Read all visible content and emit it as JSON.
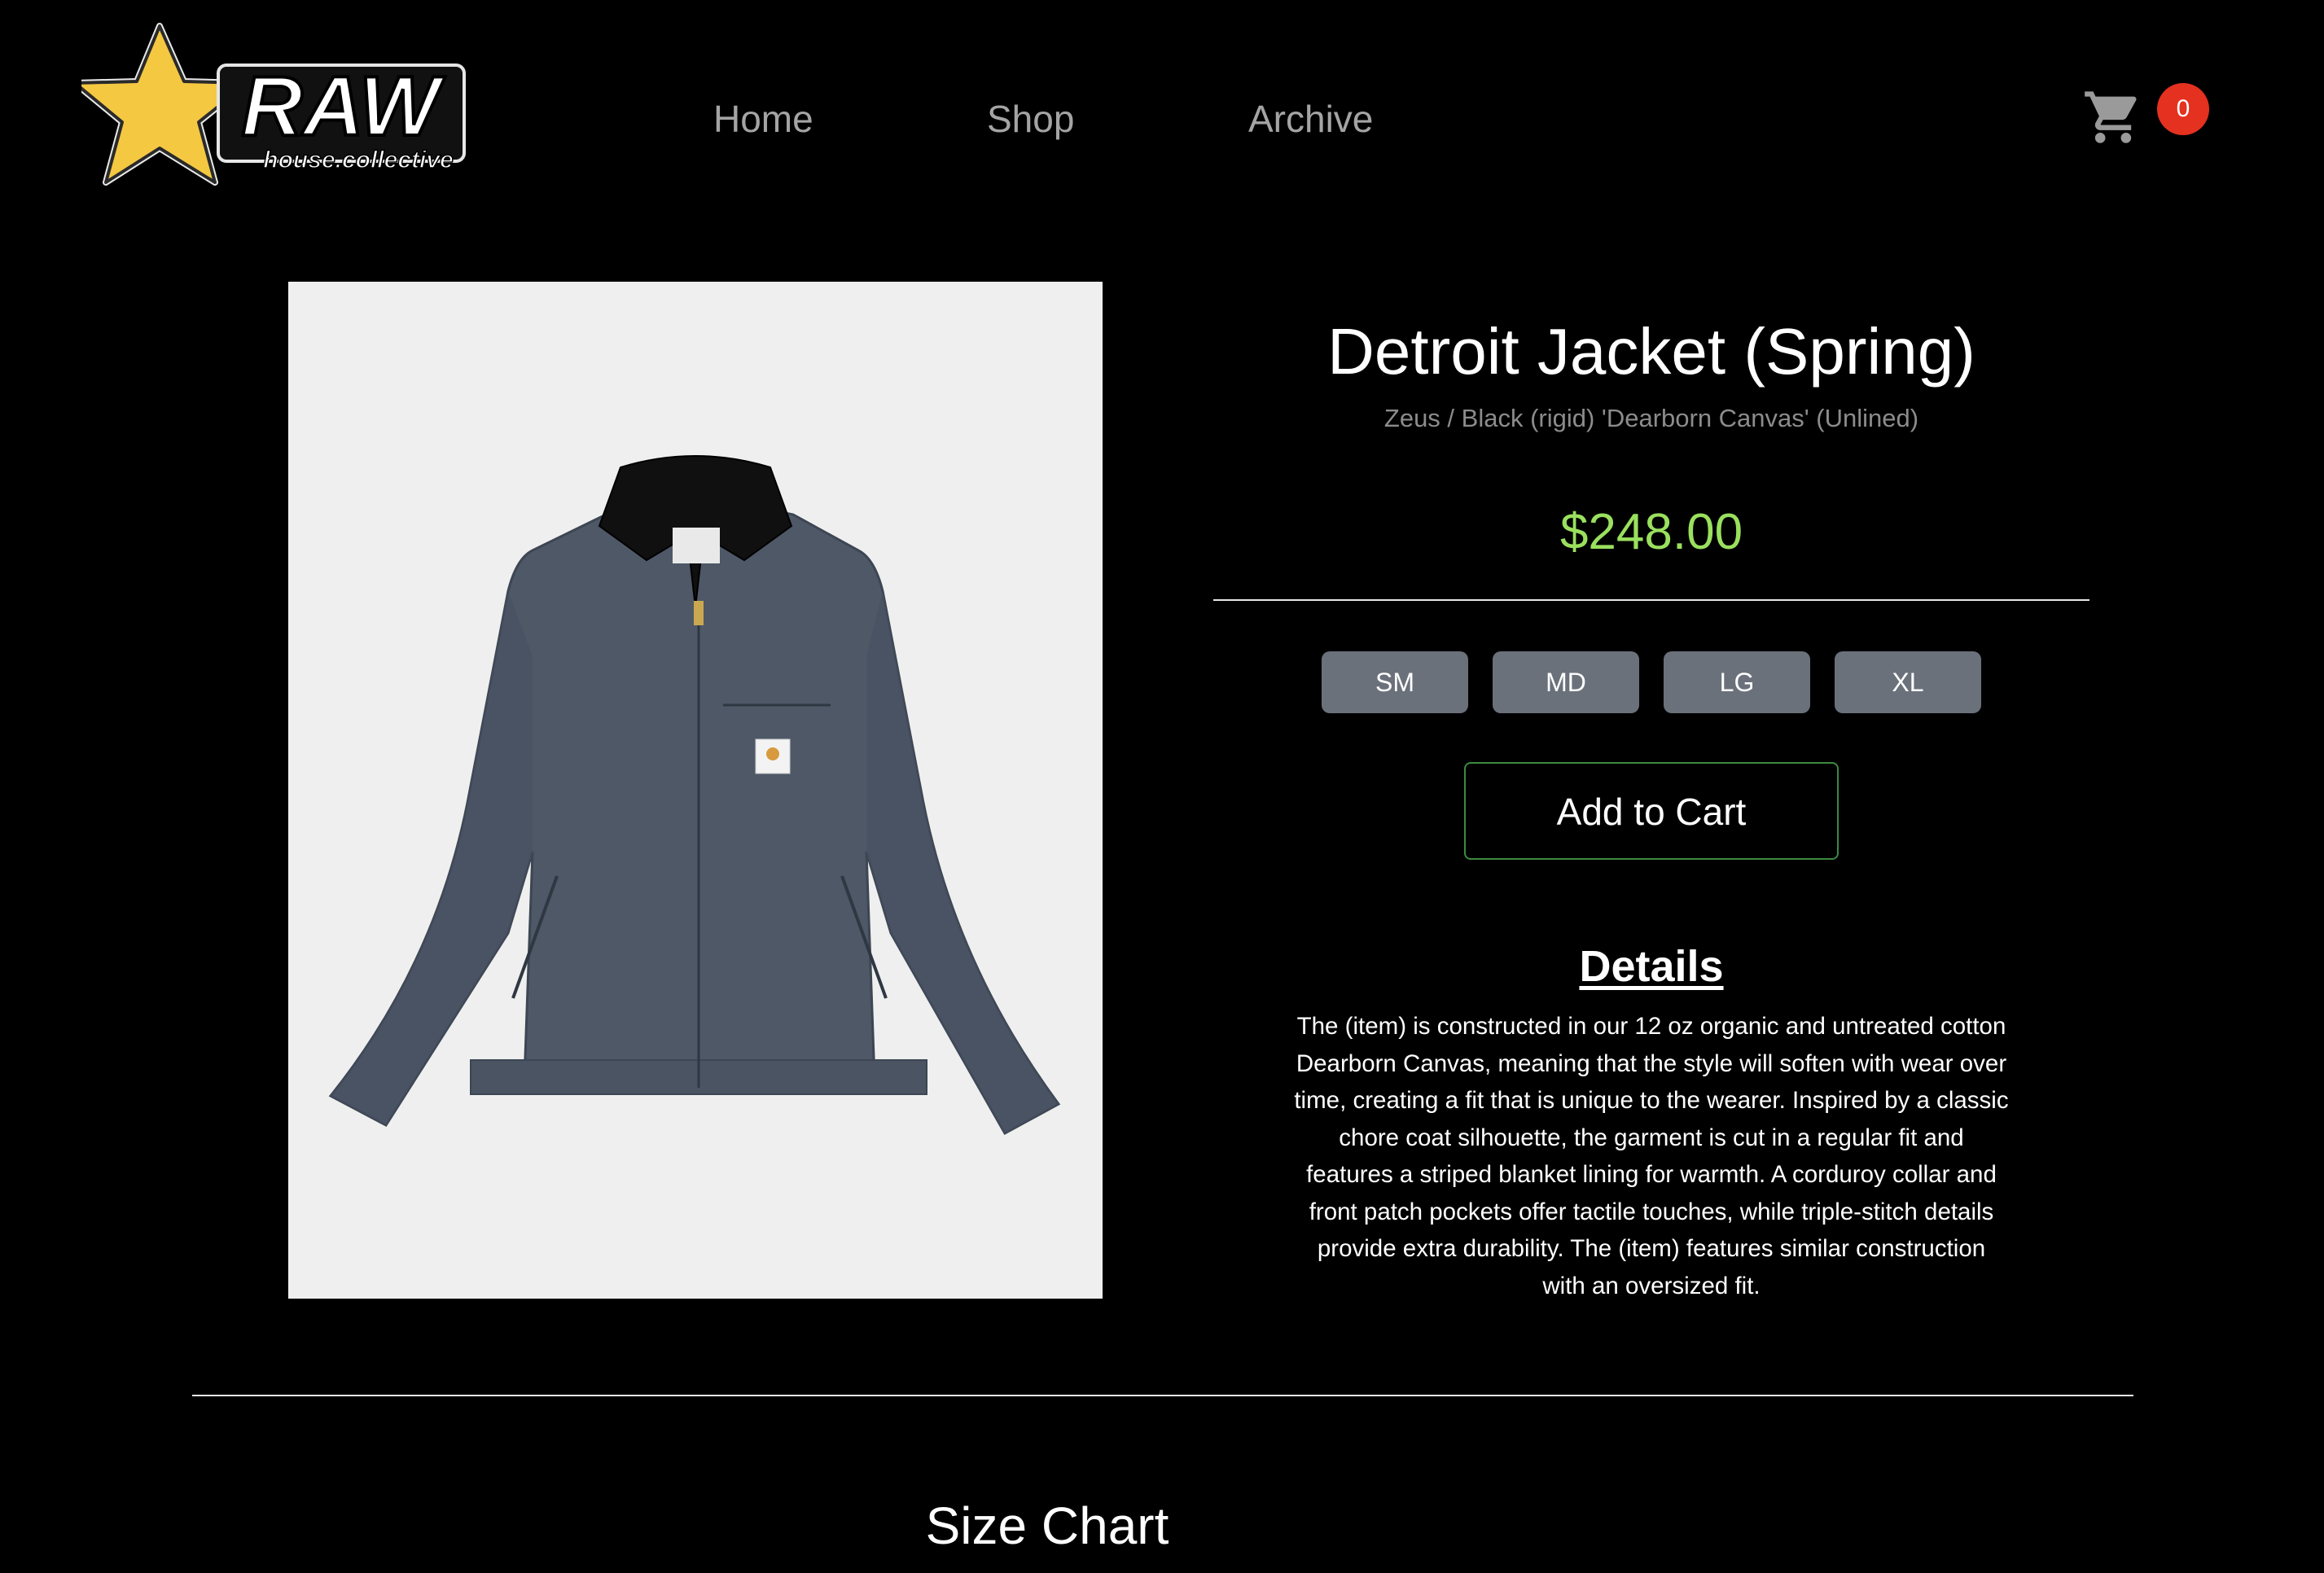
{
  "header": {
    "logo": {
      "name": "RAW",
      "tagline": "house.collective"
    },
    "nav": [
      {
        "label": "Home"
      },
      {
        "label": "Shop"
      },
      {
        "label": "Archive"
      }
    ],
    "cart": {
      "icon": "shopping-cart-icon",
      "count": "0",
      "badge_color": "#e5311f"
    }
  },
  "product": {
    "image_alt": "Slate grey zip jacket with black corduroy collar",
    "title": "Detroit Jacket (Spring)",
    "subtitle": "Zeus / Black (rigid) 'Dearborn Canvas' (Unlined)",
    "price": "$248.00",
    "price_color": "#9ae05e",
    "sizes": [
      "SM",
      "MD",
      "LG",
      "XL"
    ],
    "add_to_cart_label": "Add to Cart",
    "details_heading": "Details",
    "details_text": "The (item) is constructed in our 12 oz organic and untreated cotton Dearborn Canvas, meaning that the style will soften with wear over time, creating a fit that is unique to the wearer. Inspired by a classic chore coat silhouette, the garment is cut in a regular fit and features a striped blanket lining for warmth. A corduroy collar and front patch pockets offer tactile touches, while triple-stitch details provide extra durability. The (item) features similar construction with an oversized fit."
  },
  "size_chart": {
    "title": "Size Chart"
  }
}
